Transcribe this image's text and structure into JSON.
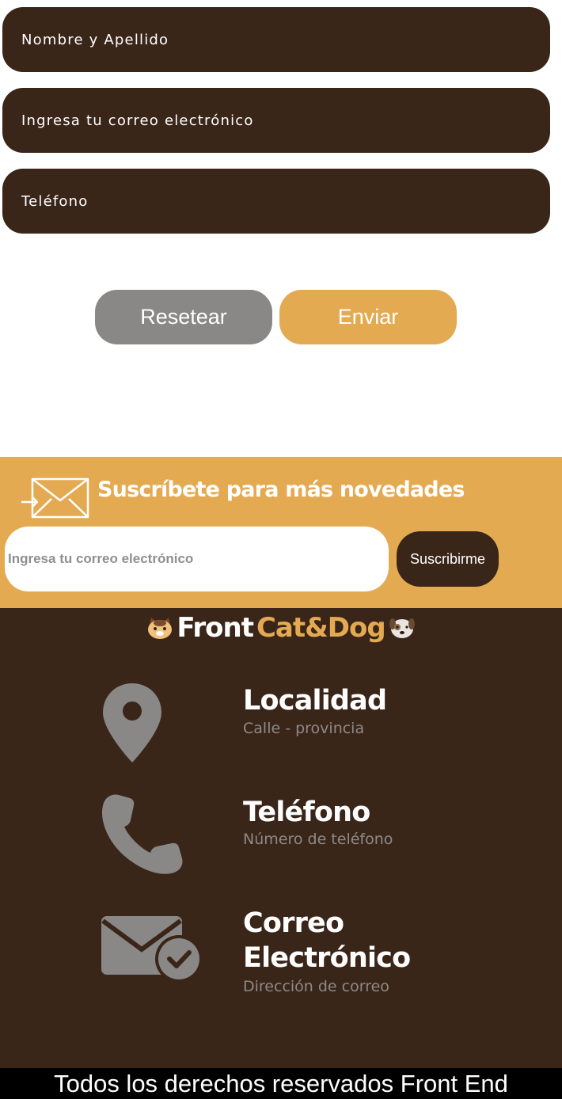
{
  "form": {
    "name_placeholder": "Nombre y Apellido",
    "email_placeholder": "Ingresa tu correo electrónico",
    "phone_placeholder": "Teléfono",
    "reset_label": "Resetear",
    "send_label": "Enviar"
  },
  "subscribe": {
    "title": "Suscríbete para más novedades",
    "email_placeholder": "Ingresa tu correo electrónico",
    "button_label": "Suscribirme",
    "icon": "envelope-icon"
  },
  "footer": {
    "brand_white": "Front",
    "brand_gold": "Cat&Dog",
    "info": [
      {
        "icon": "location-pin-icon",
        "title": "Localidad",
        "subtitle": "Calle - provincia"
      },
      {
        "icon": "phone-icon",
        "title": "Teléfono",
        "subtitle": "Número de teléfono"
      },
      {
        "icon": "mail-check-icon",
        "title_line1": "Correo",
        "title_line2": "Electrónico",
        "subtitle": "Dirección de correo"
      }
    ],
    "copyright": "Todos los derechos reservados Front End"
  },
  "colors": {
    "brown": "#3a2519",
    "gold": "#e4aa52",
    "gray": "#8a8787"
  }
}
